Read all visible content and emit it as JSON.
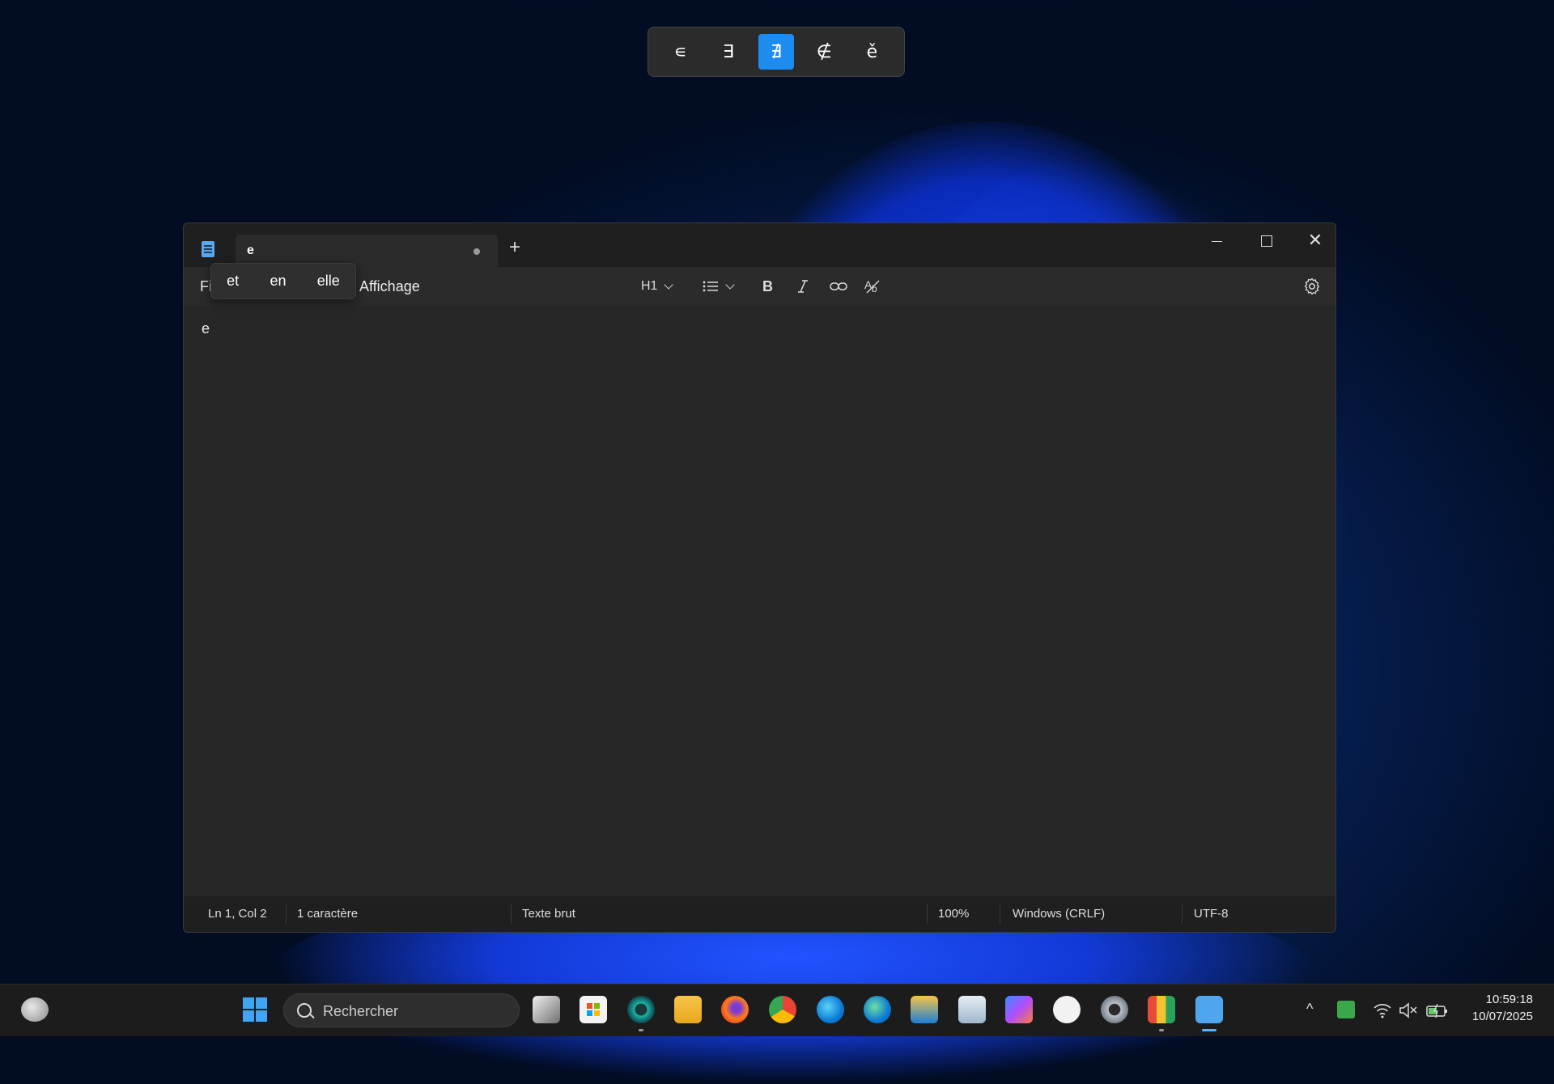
{
  "symbol_picker": {
    "items": [
      "∊",
      "∃",
      "∄",
      "∉",
      "ě"
    ],
    "selected_index": 2
  },
  "window": {
    "tab_title": "e",
    "tab_unsaved_indicator": "●",
    "new_tab_label": "+",
    "controls": {
      "minimize": "—",
      "maximize": "□",
      "close": "✕"
    }
  },
  "menubar": {
    "file_partial": "Fi",
    "view": "Affichage"
  },
  "toolbar": {
    "heading": "H1",
    "list_icon": "list-icon",
    "bold_icon": "bold-icon",
    "italic_icon": "italic-icon",
    "link_icon": "link-icon",
    "clear_format_icon": "clear-format-icon",
    "settings_icon": "gear-icon"
  },
  "suggestions": [
    "et",
    "en",
    "elle"
  ],
  "editor": {
    "content": "e"
  },
  "statusbar": {
    "position": "Ln 1, Col 2",
    "chars": "1 caractère",
    "format": "Texte brut",
    "zoom": "100%",
    "line_endings": "Windows (CRLF)",
    "encoding": "UTF-8"
  },
  "taskbar": {
    "search_placeholder": "Rechercher",
    "time": "10:59:18",
    "date": "10/07/2025"
  },
  "colors": {
    "accent": "#1c8cf0",
    "editor_bg": "#272727",
    "titlebar_bg": "#1f1f1f"
  }
}
